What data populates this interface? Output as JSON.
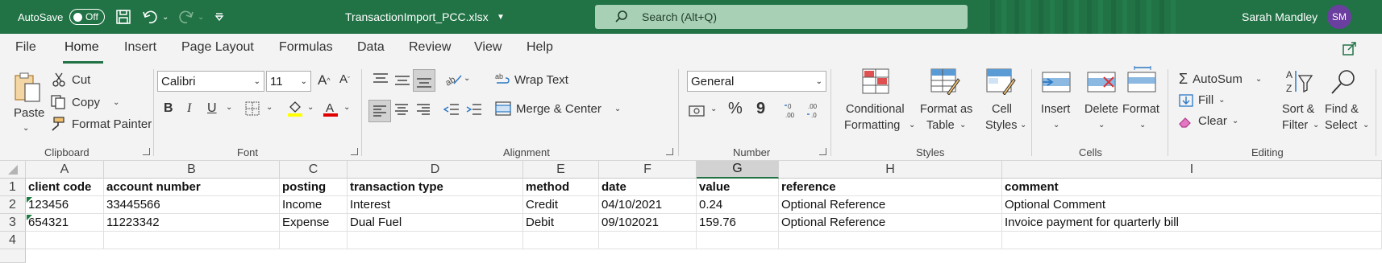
{
  "titlebar": {
    "autosave_label": "AutoSave",
    "autosave_state": "Off",
    "filename": "TransactionImport_PCC.xlsx",
    "search_placeholder": "Search (Alt+Q)",
    "user_name": "Sarah Mandley",
    "user_initials": "SM",
    "accent": "#217346"
  },
  "menu": {
    "file": "File",
    "home": "Home",
    "insert": "Insert",
    "page_layout": "Page Layout",
    "formulas": "Formulas",
    "data": "Data",
    "review": "Review",
    "view": "View",
    "help": "Help"
  },
  "ribbon": {
    "clipboard": {
      "paste": "Paste",
      "cut": "Cut",
      "copy": "Copy",
      "format_painter": "Format Painter",
      "group": "Clipboard"
    },
    "font": {
      "name": "Calibri",
      "size": "11",
      "bold": "B",
      "italic": "I",
      "underline": "U",
      "group": "Font"
    },
    "alignment": {
      "wrap_text": "Wrap Text",
      "merge_center": "Merge & Center",
      "group": "Alignment"
    },
    "number": {
      "format": "General",
      "percent": "%",
      "comma": "9",
      "group": "Number"
    },
    "styles": {
      "conditional_1": "Conditional",
      "conditional_2": "Formatting",
      "format_table_1": "Format as",
      "format_table_2": "Table",
      "cell_styles_1": "Cell",
      "cell_styles_2": "Styles",
      "group": "Styles"
    },
    "cells": {
      "insert": "Insert",
      "delete": "Delete",
      "format": "Format",
      "group": "Cells"
    },
    "editing": {
      "autosum": "AutoSum",
      "fill": "Fill",
      "clear": "Clear",
      "sort_1": "Sort &",
      "sort_2": "Filter",
      "find_1": "Find &",
      "find_2": "Select",
      "group": "Editing"
    }
  },
  "sheet": {
    "columns": [
      "A",
      "B",
      "C",
      "D",
      "E",
      "F",
      "G",
      "H",
      "I"
    ],
    "selected_column": "G",
    "row_numbers": [
      "1",
      "2",
      "3",
      "4"
    ],
    "rows": [
      [
        "client code",
        "account number",
        "posting",
        "transaction type",
        "method",
        "date",
        "value",
        "reference",
        "comment"
      ],
      [
        "123456",
        "33445566",
        "Income",
        "Interest",
        "Credit",
        "04/10/2021",
        "0.24",
        "Optional Reference",
        "Optional Comment"
      ],
      [
        "654321",
        "11223342",
        "Expense",
        "Dual Fuel",
        "Debit",
        "09/102021",
        "159.76",
        "Optional Reference",
        "Invoice payment for quarterly bill"
      ],
      [
        "",
        "",
        "",
        "",
        "",
        "",
        "",
        "",
        ""
      ]
    ]
  }
}
